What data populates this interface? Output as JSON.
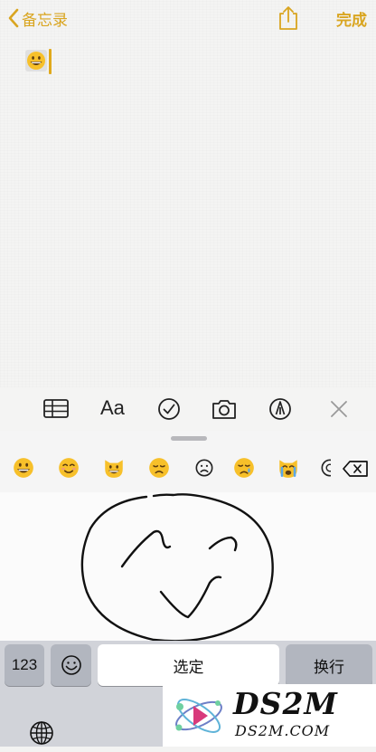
{
  "nav": {
    "back_label": "备忘录",
    "done_label": "完成"
  },
  "colors": {
    "accent": "#d9a520",
    "keyboard_bg": "#d1d3d9"
  },
  "note": {
    "content_emoji": "grinning-face"
  },
  "toolbar": {
    "format_label": "Aa",
    "icons": [
      "table-icon",
      "format-text",
      "checklist-icon",
      "camera-icon",
      "markup-pen-icon",
      "close-icon"
    ]
  },
  "emoji_bar": {
    "items": [
      "grinning-face",
      "smiling-face",
      "grinning-cat",
      "disappointed-face",
      "frowning-face",
      "crying-face",
      "crying-cat"
    ]
  },
  "keyboard": {
    "numbers_label": "123",
    "space_label": "选定",
    "return_label": "换行"
  },
  "watermark": {
    "title": "DS2M",
    "subtitle": "DS2M.COM"
  }
}
